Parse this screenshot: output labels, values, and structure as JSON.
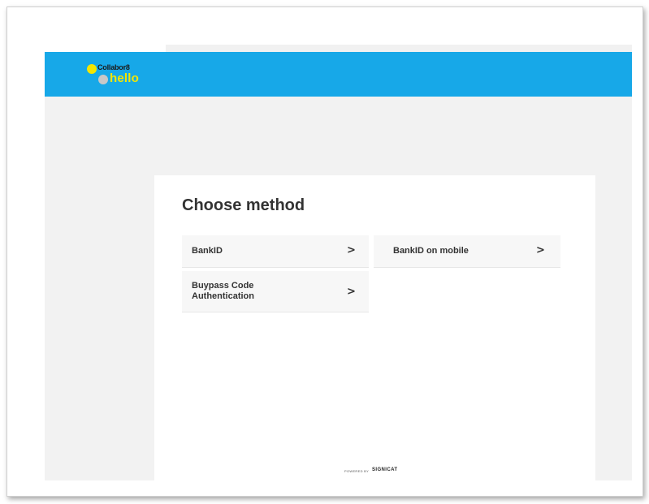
{
  "logo": {
    "line1": "Collabor8",
    "line2": "hello"
  },
  "card": {
    "title": "Choose method",
    "methods": [
      {
        "label": "BankID",
        "chevron": ">"
      },
      {
        "label": "BankID on mobile",
        "chevron": ">"
      },
      {
        "label": "Buypass Code\nAuthentication",
        "chevron": ">"
      }
    ]
  },
  "footer": {
    "powered_by": "POWERED BY",
    "brand": "SIGNICAT"
  },
  "colors": {
    "header_blue": "#17a8e8",
    "logo_yellow": "#f4e600",
    "logo_grey": "#c8c8c8",
    "background": "#f2f2f2",
    "card": "#ffffff",
    "method_bg": "#f7f7f7"
  }
}
